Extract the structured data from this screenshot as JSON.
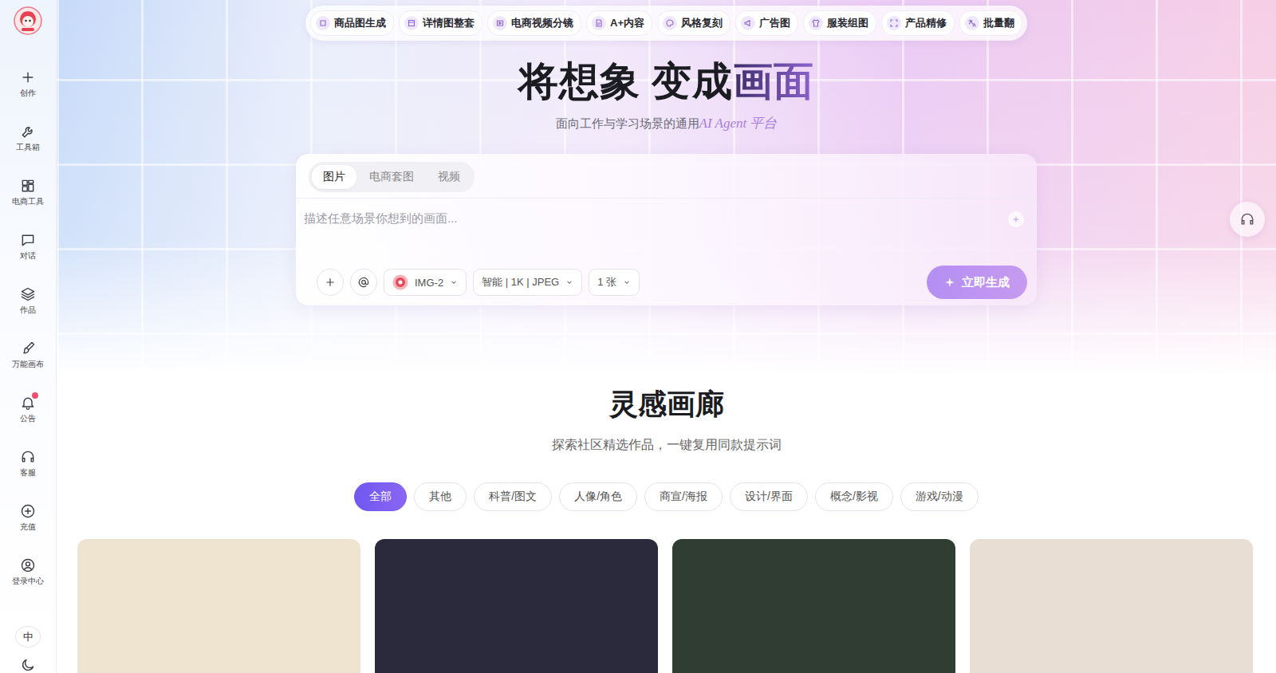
{
  "sidebar": {
    "items": [
      {
        "label": "创作",
        "notify": false
      },
      {
        "label": "工具箱",
        "notify": false
      },
      {
        "label": "电商工具",
        "notify": false
      },
      {
        "label": "对话",
        "notify": false
      },
      {
        "label": "作品",
        "notify": false
      },
      {
        "label": "万能画布",
        "notify": false
      },
      {
        "label": "公告",
        "notify": true
      },
      {
        "label": "客服",
        "notify": false
      },
      {
        "label": "充值",
        "notify": false
      },
      {
        "label": "登录中心",
        "notify": false
      }
    ],
    "language": "中"
  },
  "top_nav": {
    "items": [
      {
        "label": "商品图生成"
      },
      {
        "label": "详情图整套"
      },
      {
        "label": "电商视频分镜"
      },
      {
        "label": "A+内容"
      },
      {
        "label": "风格复刻"
      },
      {
        "label": "广告图"
      },
      {
        "label": "服装组图"
      },
      {
        "label": "产品精修"
      },
      {
        "label": "批量翻"
      }
    ]
  },
  "hero": {
    "title_plain": "将想象 变成",
    "title_accent": "画面",
    "subtitle_plain": "面向工作与学习场景的通用",
    "subtitle_accent": "AI Agent 平台"
  },
  "composer": {
    "tabs": [
      {
        "label": "图片",
        "selected": true
      },
      {
        "label": "电商套图",
        "selected": false
      },
      {
        "label": "视频",
        "selected": false
      }
    ],
    "placeholder": "描述任意场景你想到的画面...",
    "model": "IMG-2",
    "settings": "智能 | 1K | JPEG",
    "count": "1 张",
    "submit": "立即生成"
  },
  "gallery": {
    "title": "灵感画廊",
    "subtitle": "探索社区精选作品，一键复用同款提示词",
    "filters": [
      {
        "label": "全部",
        "selected": true
      },
      {
        "label": "其他",
        "selected": false
      },
      {
        "label": "科普/图文",
        "selected": false
      },
      {
        "label": "人像/角色",
        "selected": false
      },
      {
        "label": "商宣/海报",
        "selected": false
      },
      {
        "label": "设计/界面",
        "selected": false
      },
      {
        "label": "概念/影视",
        "selected": false
      },
      {
        "label": "游戏/动漫",
        "selected": false
      }
    ],
    "cards": [
      {
        "color": "#efe4d0"
      },
      {
        "color": "#2b2a3c"
      },
      {
        "color": "#2f3d33"
      },
      {
        "color": "#e8ded3"
      }
    ]
  }
}
